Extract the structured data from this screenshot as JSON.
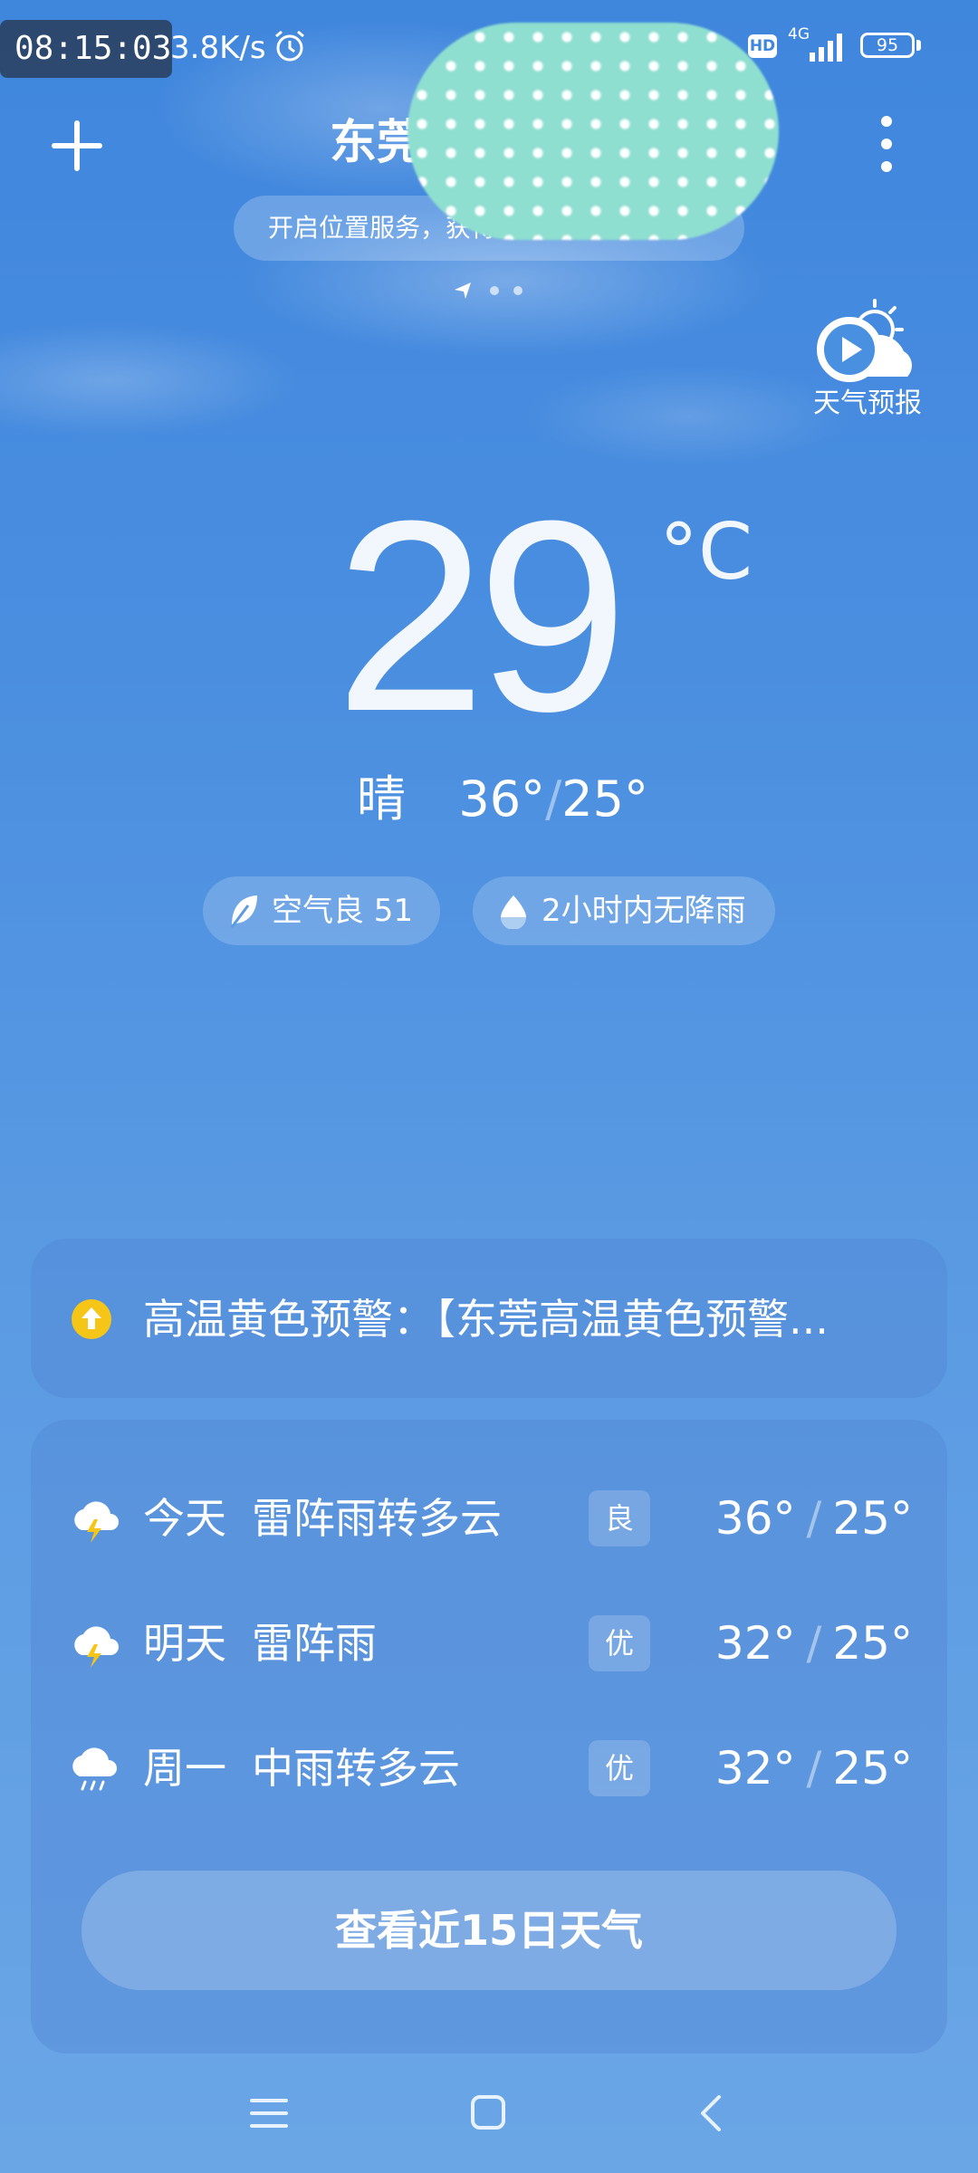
{
  "status_bar": {
    "time": "08:15:03",
    "speed": "3.8K/s",
    "hd": "HD",
    "network": "4G",
    "battery": "95",
    "icons": [
      "alarm-icon",
      "signal-icon",
      "battery-icon"
    ]
  },
  "header": {
    "city": "东莞",
    "location_tip": "开启位置服务，获得",
    "icons": [
      "add-icon",
      "more-icon",
      "location-arrow-icon"
    ]
  },
  "forecast_video": {
    "label": "天气预报",
    "icon": "play-weather-icon"
  },
  "current": {
    "temperature": "29",
    "unit": "°C",
    "condition": "晴",
    "high": "36°",
    "low": "25°",
    "separator": "/"
  },
  "pills": {
    "aqi": "空气良 51",
    "rain": "2小时内无降雨",
    "icons": [
      "leaf-icon",
      "water-drop-icon"
    ]
  },
  "alert": {
    "text": "高温黄色预警：【东莞高温黄色预警...",
    "icon": "warning-up-arrow-icon",
    "color": "#f5c518"
  },
  "daily": [
    {
      "day": "今天",
      "condition": "雷阵雨转多云",
      "aq": "良",
      "high": "36°",
      "low": "25°",
      "icon": "thunderstorm-icon"
    },
    {
      "day": "明天",
      "condition": "雷阵雨",
      "aq": "优",
      "high": "32°",
      "low": "25°",
      "icon": "thunderstorm-icon"
    },
    {
      "day": "周一",
      "condition": "中雨转多云",
      "aq": "优",
      "high": "32°",
      "low": "25°",
      "icon": "rain-icon"
    }
  ],
  "view_more_label": "查看近15日天气",
  "nav": {
    "icons": [
      "menu-icon",
      "home-icon",
      "back-icon"
    ]
  }
}
